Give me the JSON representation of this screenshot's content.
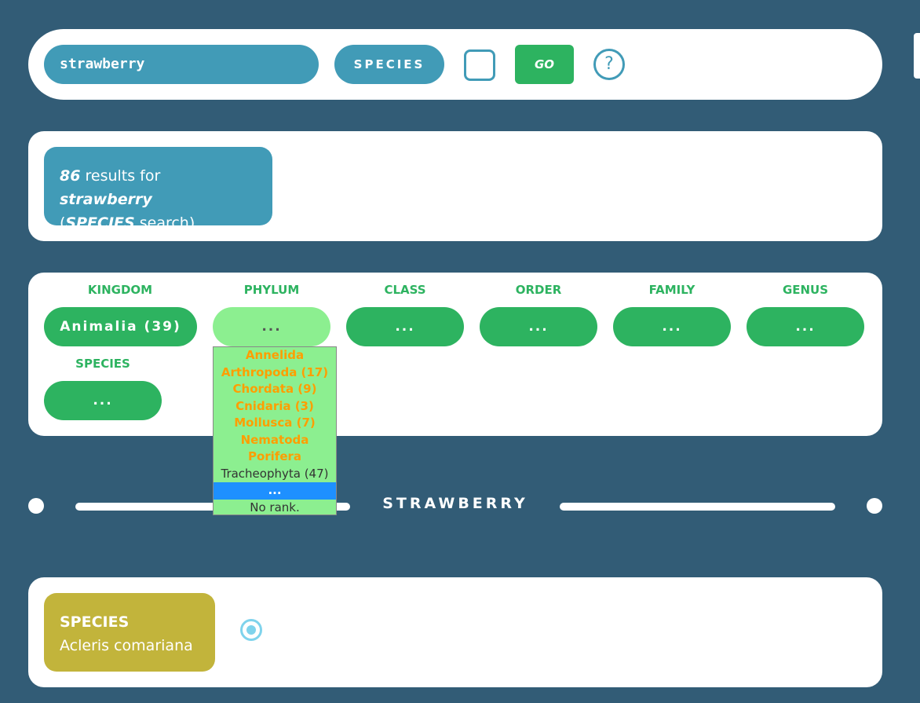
{
  "search": {
    "query": "strawberry",
    "rank_button": "SPECIES",
    "go_label": "GO",
    "help_symbol": "?"
  },
  "results": {
    "count": "86",
    "text_results_for": " results for ",
    "query": "strawberry",
    "open_paren": "(",
    "rank": "SPECIES",
    "text_search": " search)"
  },
  "taxonomy": {
    "kingdom": {
      "label": "KINGDOM",
      "value": "Animalia (39)"
    },
    "phylum": {
      "label": "PHYLUM",
      "value": "..."
    },
    "class": {
      "label": "CLASS",
      "value": "..."
    },
    "order": {
      "label": "ORDER",
      "value": "..."
    },
    "family": {
      "label": "FAMILY",
      "value": "..."
    },
    "genus": {
      "label": "GENUS",
      "value": "..."
    },
    "species": {
      "label": "SPECIES",
      "value": "..."
    }
  },
  "phylum_dropdown": {
    "options": [
      "Annelida",
      "Arthropoda (17)",
      "Chordata (9)",
      "Cnidaria (3)",
      "Mollusca (7)",
      "Nematoda",
      "Porifera",
      "Tracheophyta (47)",
      "...",
      "No rank."
    ]
  },
  "divider": {
    "title": "STRAWBERRY"
  },
  "result_card": {
    "rank": "SPECIES",
    "name": "Acleris comariana"
  },
  "colors": {
    "background": "#325c76",
    "accent_blue": "#419bb7",
    "green": "#2db360",
    "light_green": "#8cef90",
    "orange": "#ff9e00",
    "olive": "#c2b43b",
    "selected_blue": "#1e90ff"
  },
  "icons": {
    "help": "question-circle-icon",
    "radio": "radio-selected-icon"
  }
}
